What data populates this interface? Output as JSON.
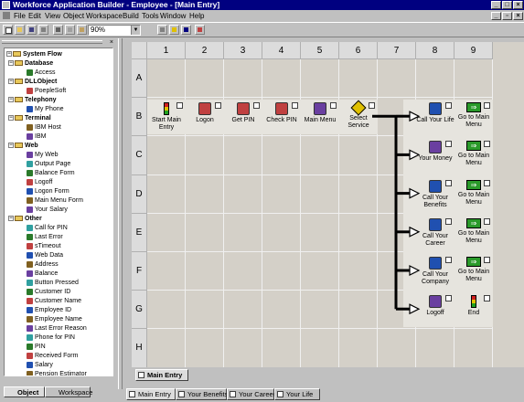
{
  "window": {
    "title": "Workforce Application Builder - Employee - [Main Entry]"
  },
  "menu": [
    "File",
    "Edit",
    "View",
    "Object",
    "Workspace",
    "Build",
    "Tools",
    "Window",
    "Help"
  ],
  "toolbar": {
    "zoom": "90%"
  },
  "tree": {
    "root": "System Flow",
    "groups": [
      {
        "label": "Database",
        "items": [
          "Access"
        ]
      },
      {
        "label": "DLLObject",
        "items": [
          "PoepleSoft"
        ]
      },
      {
        "label": "Telephony",
        "items": [
          "My Phone"
        ]
      },
      {
        "label": "Terminal",
        "items": [
          "IBM Host",
          "IBM"
        ]
      },
      {
        "label": "Web",
        "items": [
          "My Web",
          "Output Page",
          "Balance Form",
          "Logoff",
          "Logon Form",
          "Main Menu Form",
          "Your Salary"
        ]
      },
      {
        "label": "Other",
        "items": [
          "Call for PIN",
          "Last Error",
          "sTimeout",
          "Web Data",
          "Address",
          "Balance",
          "Button Pressed",
          "Customer ID",
          "Customer Name",
          "Employee ID",
          "Employee Name",
          "Last Error Reason",
          "Phone for PIN",
          "PIN",
          "Received Form",
          "Salary",
          "Pension Estimator"
        ]
      }
    ]
  },
  "panel_tabs": [
    "Object",
    "Workspace"
  ],
  "grid": {
    "columns": [
      "1",
      "2",
      "3",
      "4",
      "5",
      "6",
      "7",
      "8",
      "9"
    ],
    "rows": [
      "A",
      "B",
      "C",
      "D",
      "E",
      "F",
      "G",
      "H"
    ],
    "nodes": [
      {
        "label": "Start Main Entry"
      },
      {
        "label": "Logon"
      },
      {
        "label": "Get PIN"
      },
      {
        "label": "Check PIN"
      },
      {
        "label": "Main Menu"
      },
      {
        "label": "Select Service"
      },
      {
        "label": "Call Your Life"
      },
      {
        "label": "Go to Main Menu"
      },
      {
        "label": "Your Money"
      },
      {
        "label": "Go to Main Menu"
      },
      {
        "label": "Call Your Benefits"
      },
      {
        "label": "Go to Main Menu"
      },
      {
        "label": "Call Your Career"
      },
      {
        "label": "Go to Main Menu"
      },
      {
        "label": "Call Your Company"
      },
      {
        "label": "Go to Main Menu"
      },
      {
        "label": "Logoff"
      },
      {
        "label": "End"
      }
    ]
  },
  "sheet_tab": "Main Entry",
  "doc_tabs": [
    "Main Entry",
    "Your Benefits",
    "Your Career",
    "Your Life"
  ],
  "colors": {
    "titlebar": "#000080",
    "face": "#c0c0c0",
    "grid": "#d4d0c8"
  }
}
